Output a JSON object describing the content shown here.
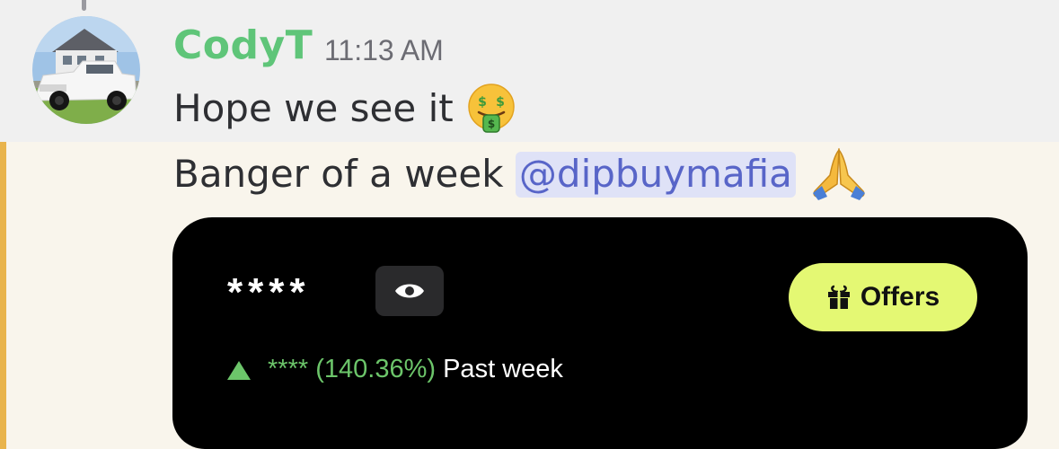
{
  "message": {
    "username": "CodyT",
    "timestamp": "11:13 AM",
    "line1": {
      "text": "Hope we see it",
      "emoji": "money-mouth-face-emoji"
    },
    "line2": {
      "text": "Banger of a week",
      "mention": "@dipbuymafia",
      "emoji": "folded-hands-emoji"
    }
  },
  "embed": {
    "balance_masked": "****",
    "eye_icon": "eye-icon",
    "offers_label": "Offers",
    "offers_icon": "gift-icon",
    "change_masked": "****",
    "change_percent": "(140.36%)",
    "period": "Past week",
    "trend_icon": "up-triangle-icon"
  },
  "colors": {
    "username": "#5fc579",
    "mention_text": "#5865c8",
    "mention_bg": "#dfe2f7",
    "highlight_bar": "#e9b44c",
    "offers_bg": "#e4f873",
    "gain_green": "#6cc56a"
  }
}
